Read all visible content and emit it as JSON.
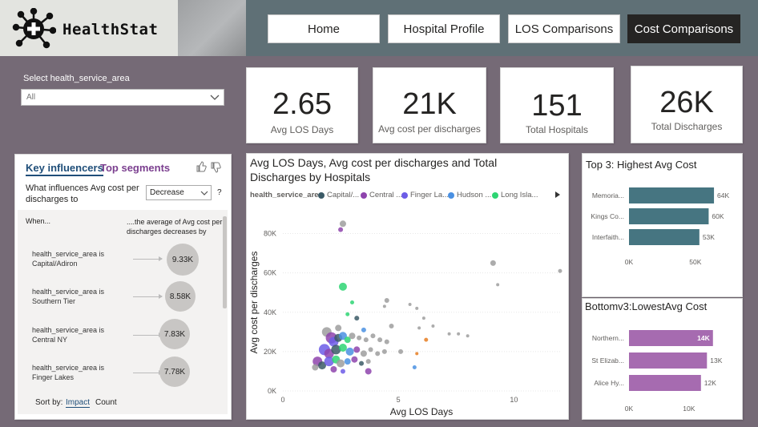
{
  "app": {
    "name": "HealthStat"
  },
  "nav": {
    "home": "Home",
    "hospital_profile": "Hospital Profile",
    "los_comparisons": "LOS Comparisons",
    "cost_comparisons": "Cost Comparisons"
  },
  "slicer": {
    "label": "Select health_service_area",
    "value": "All"
  },
  "kpis": [
    {
      "value": "2.65",
      "label": "Avg LOS Days"
    },
    {
      "value": "21K",
      "label": "Avg cost per discharges"
    },
    {
      "value": "151",
      "label": "Total Hospitals"
    },
    {
      "value": "26K",
      "label": "Total Discharges"
    }
  ],
  "key_influencers": {
    "tab_active": "Key influencers",
    "tab_other": "Top segments",
    "question": "What influences Avg cost per discharges to",
    "direction": "Decrease",
    "help": "?",
    "col_when": "When...",
    "col_effect": "....the average of Avg cost per discharges decreases by",
    "rows": [
      {
        "label": "health_service_area is Capital/Adiron",
        "value": "9.33K",
        "fill": 0.93
      },
      {
        "label": "health_service_area is Southern Tier",
        "value": "8.58K",
        "fill": 0.86
      },
      {
        "label": "health_service_area is Central NY",
        "value": "7.83K",
        "fill": 0.78
      },
      {
        "label": "health_service_area is Finger Lakes",
        "value": "7.78K",
        "fill": 0.78
      }
    ],
    "sort_label": "Sort by:",
    "sort_impact": "Impact",
    "sort_count": "Count"
  },
  "scatter": {
    "title": "Avg LOS Days, Avg cost per discharges and Total Discharges by Hospitals",
    "legend_title": "health_service_area",
    "legend": [
      {
        "name": "Capital/...",
        "color": "#3b5a66"
      },
      {
        "name": "Central ...",
        "color": "#8e44ad"
      },
      {
        "name": "Finger La...",
        "color": "#6c5ce7"
      },
      {
        "name": "Hudson ...",
        "color": "#4a90e2"
      },
      {
        "name": "Long Isla...",
        "color": "#2ed573"
      }
    ]
  },
  "chart_data": [
    {
      "type": "scatter",
      "title": "Avg LOS Days, Avg cost per discharges and Total Discharges by Hospitals",
      "xlabel": "Avg LOS Days",
      "ylabel": "Avg cost per discharges",
      "xlim": [
        0,
        12
      ],
      "ylim": [
        0,
        90000
      ],
      "x_ticks": [
        "0",
        "5",
        "10"
      ],
      "y_ticks": [
        "0K",
        "20K",
        "40K",
        "60K",
        "80K"
      ],
      "points": [
        {
          "x": 2.6,
          "y": 85000,
          "r": 4,
          "c": "#9e9e9e"
        },
        {
          "x": 2.5,
          "y": 82000,
          "r": 3,
          "c": "#8e44ad"
        },
        {
          "x": 9.1,
          "y": 65000,
          "r": 3.5,
          "c": "#9e9e9e"
        },
        {
          "x": 12,
          "y": 61000,
          "r": 2.5,
          "c": "#9e9e9e"
        },
        {
          "x": 9.3,
          "y": 54000,
          "r": 2,
          "c": "#9e9e9e"
        },
        {
          "x": 2.6,
          "y": 53000,
          "r": 5,
          "c": "#2ed573"
        },
        {
          "x": 3.0,
          "y": 45000,
          "r": 2.5,
          "c": "#2ed573"
        },
        {
          "x": 4.5,
          "y": 46000,
          "r": 3,
          "c": "#9e9e9e"
        },
        {
          "x": 4.4,
          "y": 43000,
          "r": 2,
          "c": "#9e9e9e"
        },
        {
          "x": 5.5,
          "y": 44000,
          "r": 2,
          "c": "#9e9e9e"
        },
        {
          "x": 5.8,
          "y": 42000,
          "r": 2,
          "c": "#9e9e9e"
        },
        {
          "x": 2.8,
          "y": 39000,
          "r": 2.5,
          "c": "#2ed573"
        },
        {
          "x": 3.2,
          "y": 37000,
          "r": 3,
          "c": "#3b5a66"
        },
        {
          "x": 6.1,
          "y": 37000,
          "r": 2,
          "c": "#9e9e9e"
        },
        {
          "x": 4.7,
          "y": 33000,
          "r": 3,
          "c": "#9e9e9e"
        },
        {
          "x": 5.9,
          "y": 32000,
          "r": 2,
          "c": "#9e9e9e"
        },
        {
          "x": 6.5,
          "y": 33000,
          "r": 2,
          "c": "#9e9e9e"
        },
        {
          "x": 7.2,
          "y": 29000,
          "r": 2,
          "c": "#9e9e9e"
        },
        {
          "x": 7.6,
          "y": 29000,
          "r": 2,
          "c": "#9e9e9e"
        },
        {
          "x": 8.0,
          "y": 28000,
          "r": 2,
          "c": "#9e9e9e"
        },
        {
          "x": 6.2,
          "y": 26000,
          "r": 2.5,
          "c": "#e67e22"
        },
        {
          "x": 5.8,
          "y": 19000,
          "r": 2,
          "c": "#e67e22"
        },
        {
          "x": 5.7,
          "y": 12000,
          "r": 2.5,
          "c": "#4a90e2"
        },
        {
          "x": 5.1,
          "y": 20000,
          "r": 3,
          "c": "#9e9e9e"
        },
        {
          "x": 1.9,
          "y": 30000,
          "r": 6,
          "c": "#9e9e9e"
        },
        {
          "x": 2.1,
          "y": 27000,
          "r": 7,
          "c": "#8e44ad"
        },
        {
          "x": 2.2,
          "y": 25000,
          "r": 6,
          "c": "#6c5ce7"
        },
        {
          "x": 2.4,
          "y": 27000,
          "r": 5,
          "c": "#3b5a66"
        },
        {
          "x": 2.6,
          "y": 28000,
          "r": 5,
          "c": "#4a90e2"
        },
        {
          "x": 2.8,
          "y": 26000,
          "r": 4,
          "c": "#2ed573"
        },
        {
          "x": 3.0,
          "y": 28000,
          "r": 4,
          "c": "#9e9e9e"
        },
        {
          "x": 3.3,
          "y": 27000,
          "r": 3,
          "c": "#9e9e9e"
        },
        {
          "x": 3.6,
          "y": 26000,
          "r": 3,
          "c": "#9e9e9e"
        },
        {
          "x": 3.9,
          "y": 28000,
          "r": 3,
          "c": "#9e9e9e"
        },
        {
          "x": 4.2,
          "y": 26000,
          "r": 3,
          "c": "#9e9e9e"
        },
        {
          "x": 4.5,
          "y": 25000,
          "r": 3,
          "c": "#9e9e9e"
        },
        {
          "x": 1.8,
          "y": 21000,
          "r": 7,
          "c": "#6c5ce7"
        },
        {
          "x": 2.0,
          "y": 19000,
          "r": 6,
          "c": "#8e44ad"
        },
        {
          "x": 2.3,
          "y": 21000,
          "r": 6,
          "c": "#3b5a66"
        },
        {
          "x": 2.6,
          "y": 22000,
          "r": 5,
          "c": "#2ed573"
        },
        {
          "x": 2.9,
          "y": 20000,
          "r": 5,
          "c": "#4a90e2"
        },
        {
          "x": 3.2,
          "y": 21000,
          "r": 4,
          "c": "#8e44ad"
        },
        {
          "x": 3.5,
          "y": 19000,
          "r": 4,
          "c": "#9e9e9e"
        },
        {
          "x": 3.8,
          "y": 21000,
          "r": 3,
          "c": "#9e9e9e"
        },
        {
          "x": 4.1,
          "y": 19000,
          "r": 3,
          "c": "#9e9e9e"
        },
        {
          "x": 4.4,
          "y": 20000,
          "r": 3,
          "c": "#9e9e9e"
        },
        {
          "x": 1.5,
          "y": 15000,
          "r": 6,
          "c": "#8e44ad"
        },
        {
          "x": 1.7,
          "y": 13000,
          "r": 5,
          "c": "#3b5a66"
        },
        {
          "x": 2.0,
          "y": 15000,
          "r": 6,
          "c": "#6c5ce7"
        },
        {
          "x": 2.3,
          "y": 16000,
          "r": 5,
          "c": "#2ed573"
        },
        {
          "x": 2.5,
          "y": 14000,
          "r": 5,
          "c": "#9e9e9e"
        },
        {
          "x": 2.8,
          "y": 15000,
          "r": 4,
          "c": "#4a90e2"
        },
        {
          "x": 3.1,
          "y": 16000,
          "r": 4,
          "c": "#8e44ad"
        },
        {
          "x": 3.4,
          "y": 14000,
          "r": 3,
          "c": "#3b5a66"
        },
        {
          "x": 3.7,
          "y": 15000,
          "r": 3,
          "c": "#9e9e9e"
        },
        {
          "x": 2.2,
          "y": 11000,
          "r": 4,
          "c": "#8e44ad"
        },
        {
          "x": 2.6,
          "y": 10000,
          "r": 3,
          "c": "#6c5ce7"
        },
        {
          "x": 3.7,
          "y": 10000,
          "r": 4,
          "c": "#8e44ad"
        },
        {
          "x": 1.4,
          "y": 12000,
          "r": 4,
          "c": "#9e9e9e"
        },
        {
          "x": 2.4,
          "y": 32000,
          "r": 4,
          "c": "#9e9e9e"
        },
        {
          "x": 3.5,
          "y": 31000,
          "r": 3,
          "c": "#4a90e2"
        }
      ]
    },
    {
      "type": "bar",
      "title": "Top 3: Highest Avg Cost",
      "categories": [
        "Memoria...",
        "Kings Co...",
        "Interfaith..."
      ],
      "values": [
        64000,
        60000,
        53000
      ],
      "value_labels": [
        "64K",
        "60K",
        "53K"
      ],
      "x_ticks": [
        "0K",
        "50K"
      ],
      "xlim": [
        0,
        70000
      ],
      "color": "#467581"
    },
    {
      "type": "bar",
      "title": "Bottomv3:LowestAvg Cost",
      "categories": [
        "Northern...",
        "St Elizab...",
        "Alice Hy..."
      ],
      "values": [
        14000,
        13000,
        12000
      ],
      "value_labels": [
        "14K",
        "13K",
        "12K"
      ],
      "x_ticks": [
        "0K",
        "10K"
      ],
      "xlim": [
        0,
        15500
      ],
      "color": "#a66bb0"
    }
  ]
}
